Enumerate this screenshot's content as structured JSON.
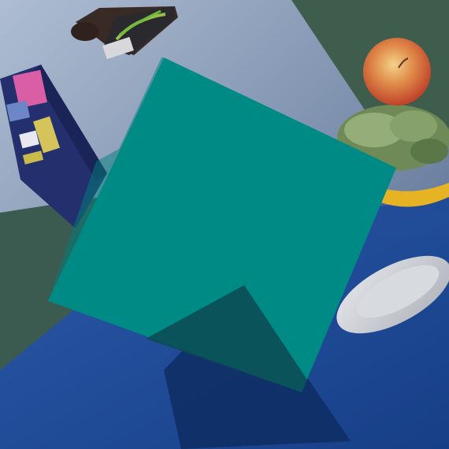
{
  "scene": {
    "colors": {
      "sky_top": "#9fb1c9",
      "sky_bottom": "#5a6f8f",
      "table_blue": "#1f4a9a",
      "table_dark": "#143a7c",
      "grass": "#3a5a48",
      "panel": "#008a86",
      "panel_shadow": "#0c4d55",
      "apple": "#d2462d",
      "apple_light": "#f0c777",
      "banana": "#e6b325",
      "cabbage": "#7f9a63",
      "plate": "#c9ccd2",
      "box_blue": "#23306d",
      "box_pink": "#d95ea6",
      "box_yellow": "#d5c45a",
      "stapler_body": "#3c2a26",
      "stapler_stripe": "#97c04a"
    },
    "objects": [
      "teal-square-panel",
      "cereal-box",
      "apple",
      "cabbage",
      "banana",
      "plate",
      "stapler",
      "cast-shadow"
    ]
  }
}
